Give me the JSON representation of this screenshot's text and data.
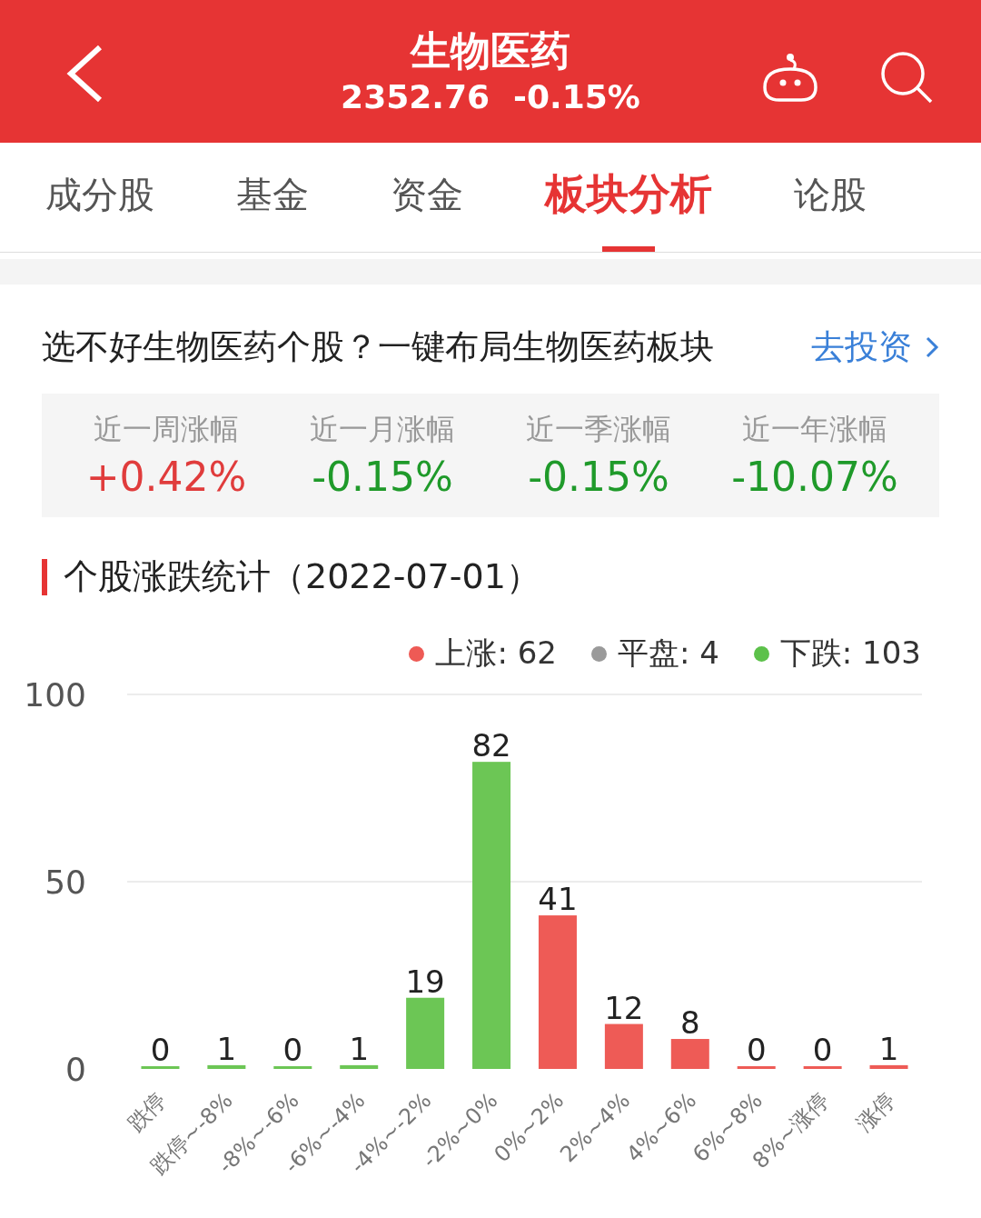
{
  "header": {
    "title": "生物医药",
    "price": "2352.76",
    "change": "-0.15%"
  },
  "tabs": [
    {
      "label": "成分股",
      "selected": false
    },
    {
      "label": "基金",
      "selected": false
    },
    {
      "label": "资金",
      "selected": false
    },
    {
      "label": "板块分析",
      "selected": true
    },
    {
      "label": "论股",
      "selected": false
    }
  ],
  "promo": {
    "text": "选不好生物医药个股？一键布局生物医药板块",
    "link": "去投资"
  },
  "stats": [
    {
      "label": "近一周涨幅",
      "value": "+0.42%",
      "color": "#e03c3c"
    },
    {
      "label": "近一月涨幅",
      "value": "-0.15%",
      "color": "#1f9a2a"
    },
    {
      "label": "近一季涨幅",
      "value": "-0.15%",
      "color": "#1f9a2a"
    },
    {
      "label": "近一年涨幅",
      "value": "-10.07%",
      "color": "#1f9a2a"
    }
  ],
  "section": {
    "title": "个股涨跌统计（2022-07-01）",
    "legend": [
      {
        "label": "上涨: 62",
        "color": "#ee5a55"
      },
      {
        "label": "平盘: 4",
        "color": "#9a9a9a"
      },
      {
        "label": "下跌: 103",
        "color": "#5cc14a"
      }
    ],
    "chart_data": {
      "type": "bar",
      "data_labels": true,
      "categories": [
        "跌停",
        "跌停~-8%",
        "-8%~-6%",
        "-6%~-4%",
        "-4%~-2%",
        "-2%~0%",
        "0%~2%",
        "2%~4%",
        "4%~6%",
        "6%~8%",
        "8%~涨停",
        "涨停"
      ],
      "series": [
        {
          "color": "#6cc655",
          "values": [
            0,
            1,
            0,
            1,
            19,
            82,
            null,
            null,
            null,
            null,
            null,
            null
          ]
        },
        {
          "color": "#ee5b56",
          "values": [
            null,
            null,
            null,
            null,
            null,
            null,
            41,
            12,
            8,
            0,
            0,
            1
          ]
        }
      ],
      "ylim": [
        0,
        100
      ],
      "yticks": [
        0,
        50,
        100
      ]
    }
  }
}
